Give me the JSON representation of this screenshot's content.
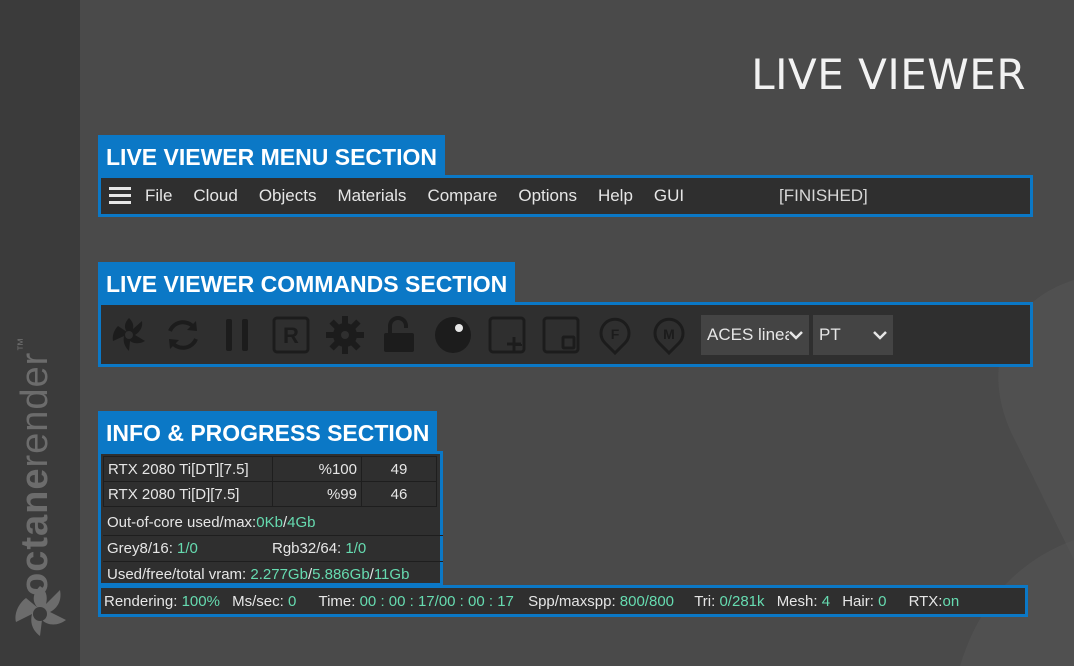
{
  "page_title": "LIVE VIEWER",
  "brand": {
    "bold": "octane",
    "light": "render",
    "tm": "™"
  },
  "sections": {
    "menu": "LIVE VIEWER MENU SECTION",
    "commands": "LIVE VIEWER COMMANDS SECTION",
    "info": "INFO & PROGRESS SECTION"
  },
  "menu": {
    "items": [
      "File",
      "Cloud",
      "Objects",
      "Materials",
      "Compare",
      "Options",
      "Help",
      "GUI"
    ],
    "status": "[FINISHED]"
  },
  "commands": {
    "icons": [
      "octane-logo-icon",
      "restart-icon",
      "pause-icon",
      "region-render-icon",
      "settings-gear-icon",
      "lock-icon",
      "clay-sphere-icon",
      "add-viewport-icon",
      "subsample-icon",
      "focus-picker-icon",
      "material-picker-icon"
    ],
    "dropdowns": [
      {
        "value": "ACES linea"
      },
      {
        "value": "PT"
      }
    ]
  },
  "info": {
    "gpus": [
      {
        "name": "RTX 2080 Ti[DT][7.5]",
        "util": "%100",
        "temp": "49"
      },
      {
        "name": "RTX 2080 Ti[D][7.5]",
        "util": "%99",
        "temp": "46"
      }
    ],
    "out_of_core": {
      "label": "Out-of-core used/max:",
      "used": "0Kb",
      "sep": "/",
      "max": "4Gb"
    },
    "grey": {
      "label": "Grey8/16: ",
      "value": "1/0"
    },
    "rgb": {
      "label": "Rgb32/64: ",
      "value": "1/0"
    },
    "vram": {
      "label": "Used/free/total vram: ",
      "used": "2.277Gb",
      "free": "5.886Gb",
      "total": "11Gb"
    }
  },
  "render": {
    "rendering_label": "Rendering: ",
    "rendering": "100%",
    "ms_label": "Ms/sec: ",
    "ms": "0",
    "time_label": "Time: ",
    "time": "00 : 00 : 17/00 : 00 : 17",
    "spp_label": "Spp/maxspp: ",
    "spp": "800/800",
    "tri_label": "Tri: ",
    "tri": "0/281k",
    "mesh_label": "Mesh: ",
    "mesh": "4",
    "hair_label": "Hair: ",
    "hair": "0",
    "rtx_label": "RTX:",
    "rtx": "on"
  },
  "colors": {
    "accent": "#0b78c6",
    "value_green": "#66dbb0",
    "panel": "#2f2f2f",
    "background": "#4a4a4a"
  }
}
